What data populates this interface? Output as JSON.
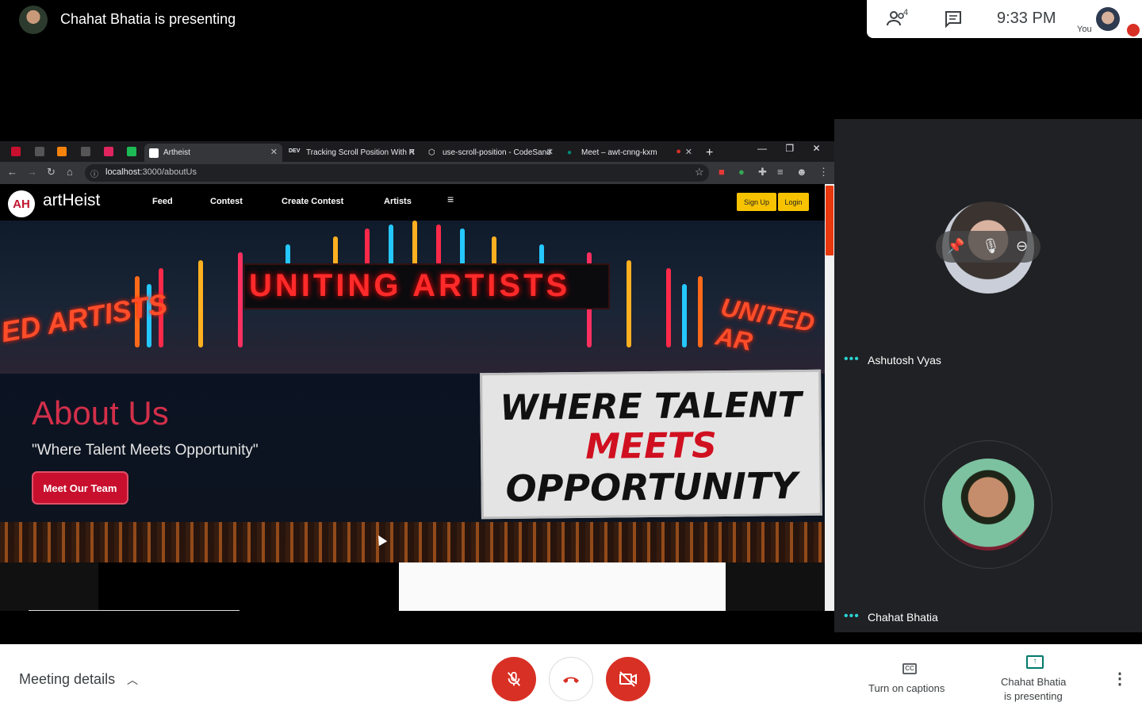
{
  "top": {
    "presenting_text": "Chahat Bhatia is presenting",
    "people_count": "4",
    "clock": "9:33 PM",
    "self_label": "You"
  },
  "browser": {
    "active_tab": "Artheist",
    "tabs": [
      {
        "label": "Tracking Scroll Position With R",
        "fav": "DEV"
      },
      {
        "label": "use-scroll-position - CodeSand",
        "fav": "⬡"
      },
      {
        "label": "Meet – awt-cnng-kxm",
        "fav": "●"
      }
    ],
    "new_tab": "+",
    "url_host": "localhost",
    "url_path": ":3000/aboutUs"
  },
  "site": {
    "logo": "AH",
    "name": "artHeist",
    "nav": [
      "Feed",
      "Contest",
      "Create Contest",
      "Artists"
    ],
    "menu_glyph": "≡",
    "signup": "Sign Up",
    "login": "Login",
    "marquee": "UNITING ARTISTS",
    "side_left": "ED ARTISTS",
    "side_right": "UNITED AR",
    "about_title": "About Us",
    "about_quote": "\"Where Talent Meets Opportunity\"",
    "team_button": "Meet Our Team",
    "billboard": [
      "WHERE TALENT",
      "MEETS",
      "OPPORTUNITY"
    ]
  },
  "participants": [
    {
      "name": "Ashutosh Vyas"
    },
    {
      "name": "Chahat Bhatia"
    }
  ],
  "bottom": {
    "meeting_details": "Meeting details",
    "captions": "Turn on captions",
    "present_line1": "Chahat Bhatia",
    "present_line2": "is presenting"
  },
  "colors": {
    "accent_red": "#d93025",
    "site_red": "#c8102e",
    "site_yellow": "#f7c300",
    "teal": "#00796b"
  }
}
